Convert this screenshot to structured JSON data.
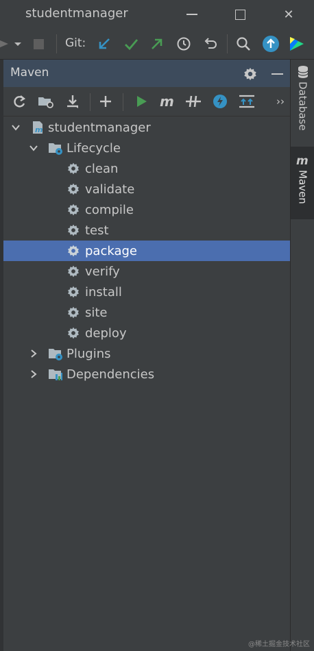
{
  "window": {
    "title": "studentmanager",
    "minimize_symbol": "—",
    "close_symbol": "✕"
  },
  "toolbar": {
    "git_label": "Git:",
    "icons": [
      "run-config-dropdown-icon",
      "stop-icon",
      "git-update-icon",
      "git-commit-icon",
      "git-push-icon",
      "history-icon",
      "rollback-icon",
      "search-icon",
      "update-icon",
      "plugin-icon"
    ]
  },
  "maven_panel": {
    "title": "Maven",
    "toolbar_icons": [
      "reload-icon",
      "reload-folder-icon",
      "download-icon",
      "add-icon",
      "run-icon",
      "maven-goal-icon",
      "toggle-offline-icon",
      "skip-tests-icon",
      "show-dependencies-icon",
      "more-icon"
    ],
    "more_symbol": "››"
  },
  "tree": {
    "project": "studentmanager",
    "lifecycle": "Lifecycle",
    "goals": [
      "clean",
      "validate",
      "compile",
      "test",
      "package",
      "verify",
      "install",
      "site",
      "deploy"
    ],
    "selected_goal": "package",
    "plugins": "Plugins",
    "dependencies": "Dependencies"
  },
  "sidebar": {
    "tabs": [
      "Database",
      "Maven"
    ],
    "active": "Maven"
  },
  "watermark": "@稀土掘金技术社区",
  "colors": {
    "background": "#3c3f41",
    "header": "#3d4b5c",
    "selection": "#4b6eaf",
    "green": "#499c54",
    "blue": "#3592c4"
  }
}
